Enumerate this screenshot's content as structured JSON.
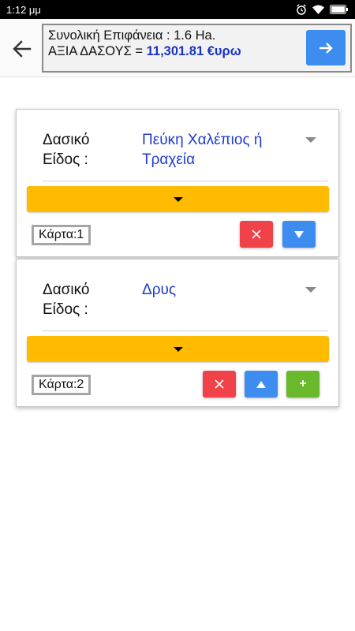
{
  "status_bar": {
    "time": "1:12 μμ"
  },
  "header": {
    "back_icon": "arrow-left-icon",
    "summary_line1": "Συνολική Επιφάνεια : 1.6 Ha.",
    "summary_line2_label": "ΑΞΙΑ ΔΑΣΟΥΣ = ",
    "summary_value": "11,301.81 €υρω",
    "go_icon": "arrow-right-icon",
    "accent_color": "#3d8cf0",
    "value_color": "#1a33c4"
  },
  "cards": [
    {
      "species_label_line1": "Δασικό",
      "species_label_line2": "Είδος :",
      "species_value": "Πεύκη Χαλέπιος ή Τραχεία",
      "card_number": "Κάρτα:1",
      "buttons": [
        "delete",
        "move-down"
      ]
    },
    {
      "species_label_line1": "Δασικό",
      "species_label_line2": "Είδος :",
      "species_value": "Δρυς",
      "card_number": "Κάρτα:2",
      "buttons": [
        "delete",
        "move-up",
        "add"
      ]
    }
  ],
  "buttons": {
    "delete_icon": "close-icon",
    "move_down_icon": "triangle-down-icon",
    "move_up_icon": "triangle-up-icon",
    "add_label": "+"
  },
  "colors": {
    "expand_bar": "#ffbb00",
    "delete": "#f04248",
    "move": "#3d8cf0",
    "add": "#6ab82c"
  }
}
